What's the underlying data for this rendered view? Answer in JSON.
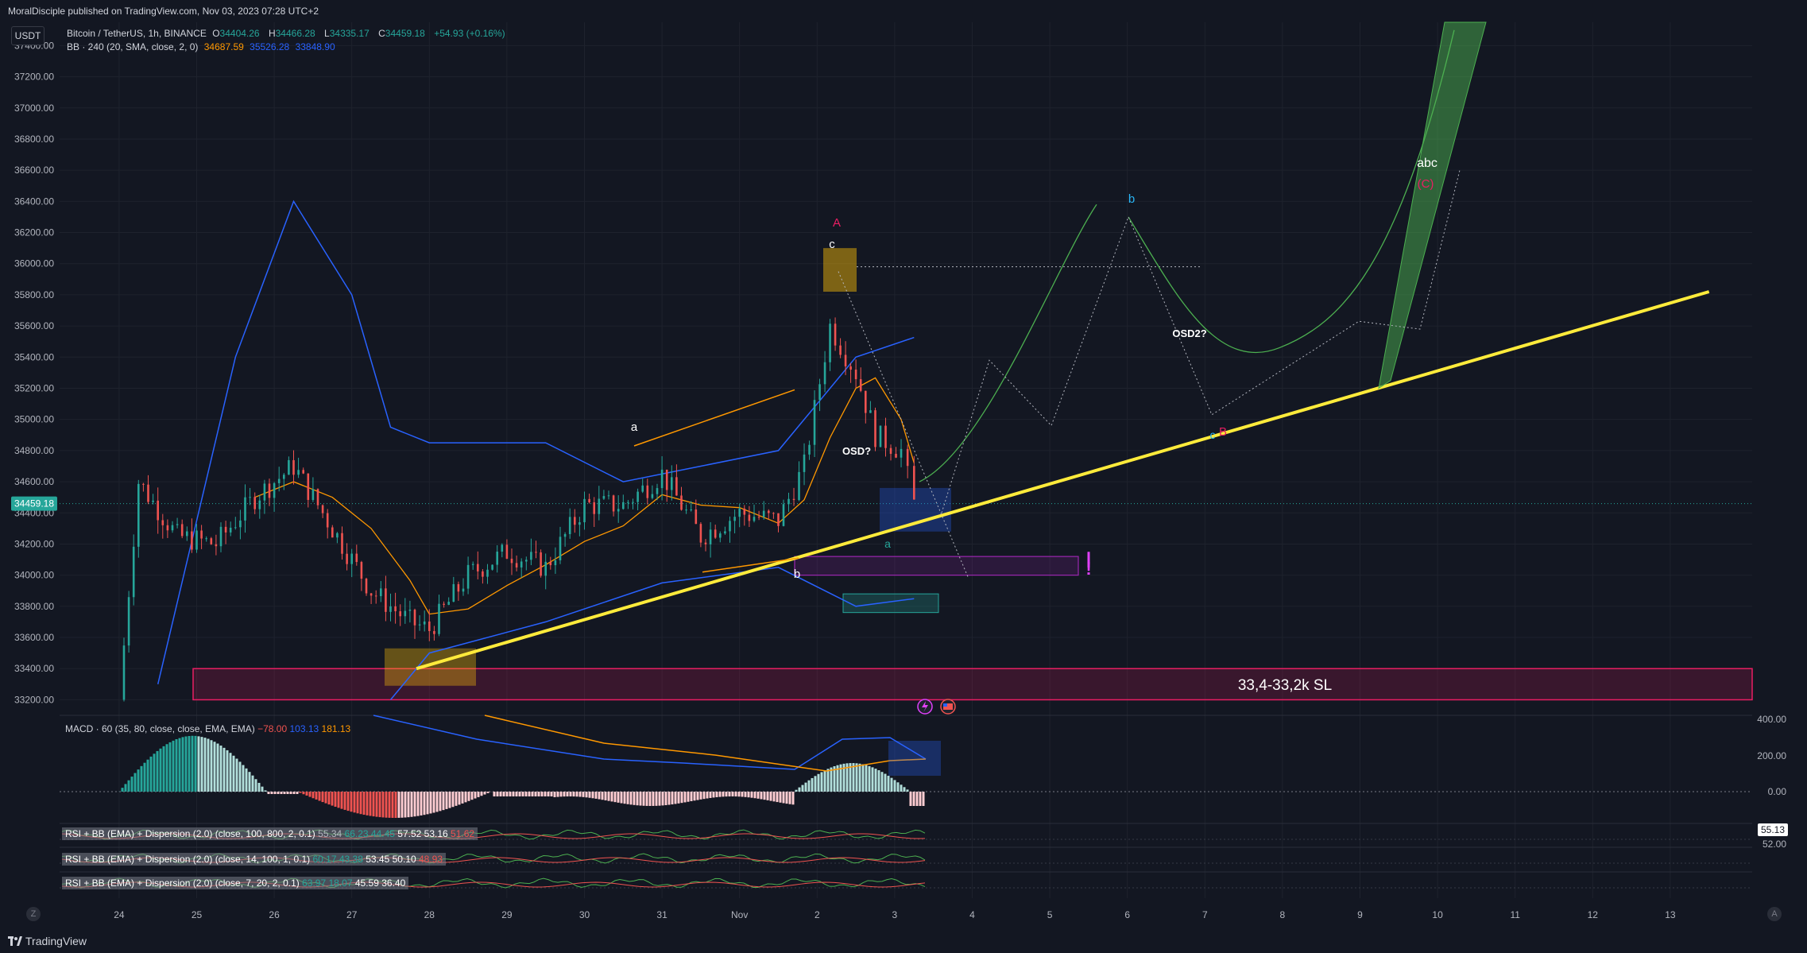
{
  "header": {
    "published": "MoralDisciple published on TradingView.com, Nov 03, 2023 07:28 UTC+2"
  },
  "footer": {
    "brand": "TradingView",
    "left_button": "Z",
    "right_button": "A"
  },
  "currency_button": "USDT",
  "colors": {
    "background": "#131722",
    "up": "#26a69a",
    "down": "#ef5350",
    "bb_basis": "#ff9800",
    "bb_band": "#2962ff",
    "trendline": "#ffeb3b",
    "sl_zone": "#e91e63",
    "price_label": "#26a69a"
  },
  "legend": {
    "symbol": "Bitcoin / TetherUS, 1h, BINANCE",
    "o_label": "O",
    "o": "34404.26",
    "h_label": "H",
    "h": "34466.28",
    "l_label": "L",
    "l": "34335.17",
    "c_label": "C",
    "c": "34459.18",
    "change": "+54.93 (+0.16%)",
    "bb_label": "BB · 240 (20, SMA, close, 2, 0)",
    "bb_basis": "34687.59",
    "bb_upper": "35526.28",
    "bb_lower": "33848.90"
  },
  "price_axis": {
    "ticks": [
      "37400.00",
      "37200.00",
      "37000.00",
      "36800.00",
      "36600.00",
      "36400.00",
      "36200.00",
      "36000.00",
      "35800.00",
      "35600.00",
      "35400.00",
      "35200.00",
      "35000.00",
      "34800.00",
      "34600.00",
      "34400.00",
      "34200.00",
      "34000.00",
      "33800.00",
      "33600.00",
      "33400.00",
      "33200.00"
    ],
    "current_price": "34459.18"
  },
  "time_axis": {
    "ticks": [
      "24",
      "25",
      "26",
      "27",
      "28",
      "29",
      "30",
      "31",
      "Nov",
      "2",
      "3",
      "4",
      "5",
      "6",
      "7",
      "8",
      "9",
      "10",
      "11",
      "12",
      "13"
    ]
  },
  "annotations": {
    "wave_a1": "a",
    "wave_A": "A",
    "wave_c": "c",
    "wave_b1": "b",
    "wave_osd": "OSD?",
    "wave_a2": "a",
    "wave_b2": "b",
    "wave_osd2": "OSD2?",
    "wave_c2": "c",
    "wave_B": "B",
    "wave_abc": "abc",
    "wave_C": "(C)",
    "exclaim": "!",
    "sl_text": "33,4-33,2k SL"
  },
  "macd": {
    "label": "MACD · 60 (35, 80, close, close, EMA, EMA)",
    "v1": "−78.00",
    "v2": "103.13",
    "v3": "181.13",
    "ticks": [
      "400.00",
      "200.00",
      "0.00"
    ]
  },
  "rsi1": {
    "label": "RSI + BB (EMA) + Dispersion (2.0) (close, 100, 800, 2, 0.1)",
    "values": [
      "55.34",
      "66.23",
      "44.45",
      "57.52",
      "53.16",
      "51.62"
    ],
    "tick": "55.13",
    "tick2": "52.00"
  },
  "rsi2": {
    "label": "RSI + BB (EMA) + Dispersion (2.0) (close, 14, 100, 1, 0.1)",
    "values": [
      "60.17",
      "43.38",
      "53.45",
      "50.10",
      "48.93"
    ]
  },
  "rsi3": {
    "label": "RSI + BB (EMA) + Dispersion (2.0) (close, 7, 20, 2, 0.1)",
    "values": [
      "63.97",
      "18.07",
      "45.59",
      "36.40"
    ]
  },
  "chart_data": {
    "type": "candlestick",
    "title": "Bitcoin / TetherUS, 1h, BINANCE",
    "y_range": [
      33100,
      37550
    ],
    "x_range_days": [
      "Oct 23",
      "Nov 14"
    ],
    "close_series_approx": [
      {
        "x": "Oct 24 00:00",
        "y": 33200
      },
      {
        "x": "Oct 24 06:00",
        "y": 34600
      },
      {
        "x": "Oct 24 18:00",
        "y": 34250
      },
      {
        "x": "Oct 25 06:00",
        "y": 34200
      },
      {
        "x": "Oct 25 18:00",
        "y": 34500
      },
      {
        "x": "Oct 26 06:00",
        "y": 34700
      },
      {
        "x": "Oct 26 18:00",
        "y": 34300
      },
      {
        "x": "Oct 27 06:00",
        "y": 33900
      },
      {
        "x": "Oct 27 18:00",
        "y": 33700
      },
      {
        "x": "Oct 28 00:00",
        "y": 33650
      },
      {
        "x": "Oct 28 12:00",
        "y": 34000
      },
      {
        "x": "Oct 29 00:00",
        "y": 34150
      },
      {
        "x": "Oct 29 12:00",
        "y": 34050
      },
      {
        "x": "Oct 30 00:00",
        "y": 34450
      },
      {
        "x": "Oct 30 12:00",
        "y": 34450
      },
      {
        "x": "Oct 31 00:00",
        "y": 34650
      },
      {
        "x": "Oct 31 12:00",
        "y": 34250
      },
      {
        "x": "Nov 1 00:00",
        "y": 34400
      },
      {
        "x": "Nov 1 12:00",
        "y": 34350
      },
      {
        "x": "Nov 1 20:00",
        "y": 34700
      },
      {
        "x": "Nov 2 04:00",
        "y": 35600
      },
      {
        "x": "Nov 2 12:00",
        "y": 35300
      },
      {
        "x": "Nov 2 18:00",
        "y": 34900
      },
      {
        "x": "Nov 3 02:00",
        "y": 34800
      },
      {
        "x": "Nov 3 06:00",
        "y": 34459
      }
    ],
    "bollinger_upper_approx": [
      {
        "x": "Oct 24 12:00",
        "y": 33300
      },
      {
        "x": "Oct 25 12:00",
        "y": 35400
      },
      {
        "x": "Oct 26 06:00",
        "y": 36400
      },
      {
        "x": "Oct 27 00:00",
        "y": 35800
      },
      {
        "x": "Oct 27 12:00",
        "y": 34950
      },
      {
        "x": "Oct 28 00:00",
        "y": 34850
      },
      {
        "x": "Oct 29 12:00",
        "y": 34850
      },
      {
        "x": "Oct 30 12:00",
        "y": 34600
      },
      {
        "x": "Oct 31 12:00",
        "y": 34700
      },
      {
        "x": "Nov 1 12:00",
        "y": 34800
      },
      {
        "x": "Nov 2 12:00",
        "y": 35400
      },
      {
        "x": "Nov 3 06:00",
        "y": 35526
      }
    ],
    "bollinger_lower_approx": [
      {
        "x": "Oct 27 12:00",
        "y": 33200
      },
      {
        "x": "Oct 28 00:00",
        "y": 33500
      },
      {
        "x": "Oct 29 12:00",
        "y": 33700
      },
      {
        "x": "Oct 31 00:00",
        "y": 33950
      },
      {
        "x": "Nov 1 12:00",
        "y": 34050
      },
      {
        "x": "Nov 2 12:00",
        "y": 33800
      },
      {
        "x": "Nov 3 06:00",
        "y": 33849
      }
    ],
    "annotations_levels": {
      "trendline": [
        {
          "x": "Oct 27 20:00",
          "y": 33400
        },
        {
          "x": "Nov 13 12:00",
          "y": 35820
        }
      ],
      "sl_zone": [
        33200,
        33400
      ],
      "resistance_dotted": 35980,
      "magenta_box": [
        34000,
        34120
      ]
    }
  }
}
